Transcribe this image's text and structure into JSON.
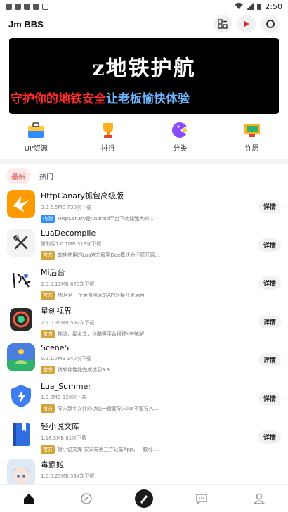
{
  "status": {
    "time": "2:50"
  },
  "app": {
    "title": "Jm BBS"
  },
  "banner": {
    "title": "z地铁护航",
    "sub_red": "守护你的地铁安全",
    "sub_blue": "让老板愉快体验"
  },
  "categories": [
    {
      "label": "UP资源",
      "icon": "toolbox-icon"
    },
    {
      "label": "排行",
      "icon": "trophy-icon"
    },
    {
      "label": "分类",
      "icon": "pacman-icon"
    },
    {
      "label": "许愿",
      "icon": "game-console-icon"
    }
  ],
  "tabs": {
    "latest": "最新",
    "hot": "热门"
  },
  "apps": [
    {
      "name": "HttpCanary抓包高级版",
      "meta": "3.3.6.5MB 730次下载",
      "tag": "内测",
      "tag_color": "#2f8cff",
      "desc": "HttpCanary是Android平台下功能强大的...",
      "detail": "详情"
    },
    {
      "name": "LuaDecompile",
      "meta": "重制版1.0.1MB 313次下载",
      "tag": "官方",
      "tag_color": "#d4a43a",
      "desc": "软件使用的Lua官方解密Dex模块为还原开源...",
      "detail": "详情"
    },
    {
      "name": "Mi后台",
      "meta": "2.0.0.11MB 870次下载",
      "tag": "官方",
      "tag_color": "#d4a43a",
      "desc": "Mi后台一个免费强大的API对接开发后台",
      "detail": "详情"
    },
    {
      "name": "星创视界",
      "meta": "2.1.0.35MB 592次下载",
      "tag": "官方",
      "tag_color": "#d4a43a",
      "desc": "韩流，星名立，优酷等平台很棒VIP破解",
      "detail": "详情"
    },
    {
      "name": "Scene5",
      "meta": "5.2.1.7MB 140次下载",
      "tag": "官方",
      "tag_color": "#d4a43a",
      "desc": "该软件性能完成达到9.3...",
      "detail": "详情"
    },
    {
      "name": "Lua_Summer",
      "meta": "1.0.6MB 120次下载",
      "tag": "官方",
      "tag_color": "#d4a43a",
      "desc": "导入那个文件的功能一键要导入lua不要导入...",
      "detail": "详情"
    },
    {
      "name": "轻小说文库",
      "meta": "1.18.3MB 81次下载",
      "tag": "官方",
      "tag_color": "#d4a43a",
      "desc": "轻小说文库-安卓端第三方公益App，一款可...",
      "detail": "详情"
    },
    {
      "name": "毒霸姬",
      "meta": "1.0.0.25MB 334次下载",
      "tag": "",
      "tag_color": "#d4a43a",
      "desc": "",
      "detail": ""
    }
  ],
  "nav": [
    {
      "icon": "home-icon"
    },
    {
      "icon": "compass-icon"
    },
    {
      "icon": "pen-icon"
    },
    {
      "icon": "chat-icon"
    },
    {
      "icon": "profile-icon"
    }
  ]
}
